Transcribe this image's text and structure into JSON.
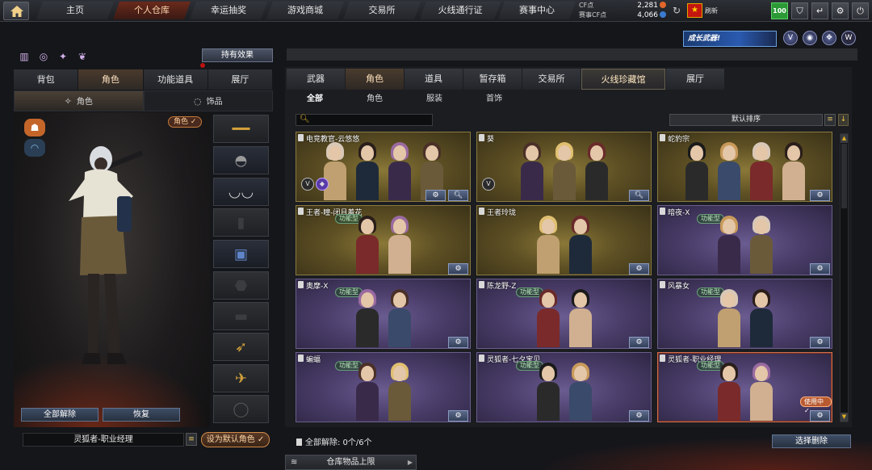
{
  "topbar": {
    "nav": [
      {
        "label": "主页",
        "active": false
      },
      {
        "label": "个人仓库",
        "active": true
      },
      {
        "label": "幸运抽奖",
        "active": false
      },
      {
        "label": "游戏商城",
        "active": false
      },
      {
        "label": "交易所",
        "active": false
      },
      {
        "label": "火线通行证",
        "active": false
      },
      {
        "label": "赛事中心",
        "active": false
      }
    ],
    "cf_label": "CF点",
    "cf_value": "2,281",
    "match_cf_label": "赛事CF点",
    "match_cf_value": "4,066",
    "player_name": "刷新",
    "level": "100"
  },
  "left": {
    "holding_effects": "持有效果",
    "tabs": [
      "背包",
      "角色",
      "功能道具",
      "展厅"
    ],
    "sub_tabs": [
      "角色",
      "饰品"
    ],
    "role_badge": "角色 ✓",
    "unequip_all": "全部解除",
    "restore": "恢复",
    "selected_character": "灵狐者-职业经理",
    "set_default": "设为默认角色 ✓"
  },
  "right": {
    "promo_text": "成长武器!",
    "main_tabs": [
      "武器",
      "角色",
      "道具",
      "暂存箱",
      "交易所",
      "火线珍藏馆",
      "展厅"
    ],
    "filters": [
      "全部",
      "角色",
      "服装",
      "首饰"
    ],
    "search_placeholder": "",
    "sort_label": "默认排序",
    "func_tag": "功能型",
    "using_badge": "使用中✓",
    "cards": [
      {
        "title": "电竞教官-云悠悠",
        "theme": "gold"
      },
      {
        "title": "葵",
        "theme": "gold"
      },
      {
        "title": "蛇豹宗",
        "theme": "gold"
      },
      {
        "title": "王者-瞳-闭月羞花",
        "theme": "gold"
      },
      {
        "title": "王者玲珑",
        "theme": "gold"
      },
      {
        "title": "暗夜-X",
        "theme": "purple"
      },
      {
        "title": "奥摩-X",
        "theme": "purple"
      },
      {
        "title": "陈龙野-Z",
        "theme": "purple"
      },
      {
        "title": "风暴女",
        "theme": "purple"
      },
      {
        "title": "蝙蝠",
        "theme": "purple"
      },
      {
        "title": "灵狐者-七夕宝贝",
        "theme": "purple"
      },
      {
        "title": "灵狐者-职业经理",
        "theme": "purple"
      }
    ],
    "bulk_remove": "全部解除: 0个/6个",
    "select_remove": "选择删除",
    "capacity": "仓库物品上限"
  }
}
